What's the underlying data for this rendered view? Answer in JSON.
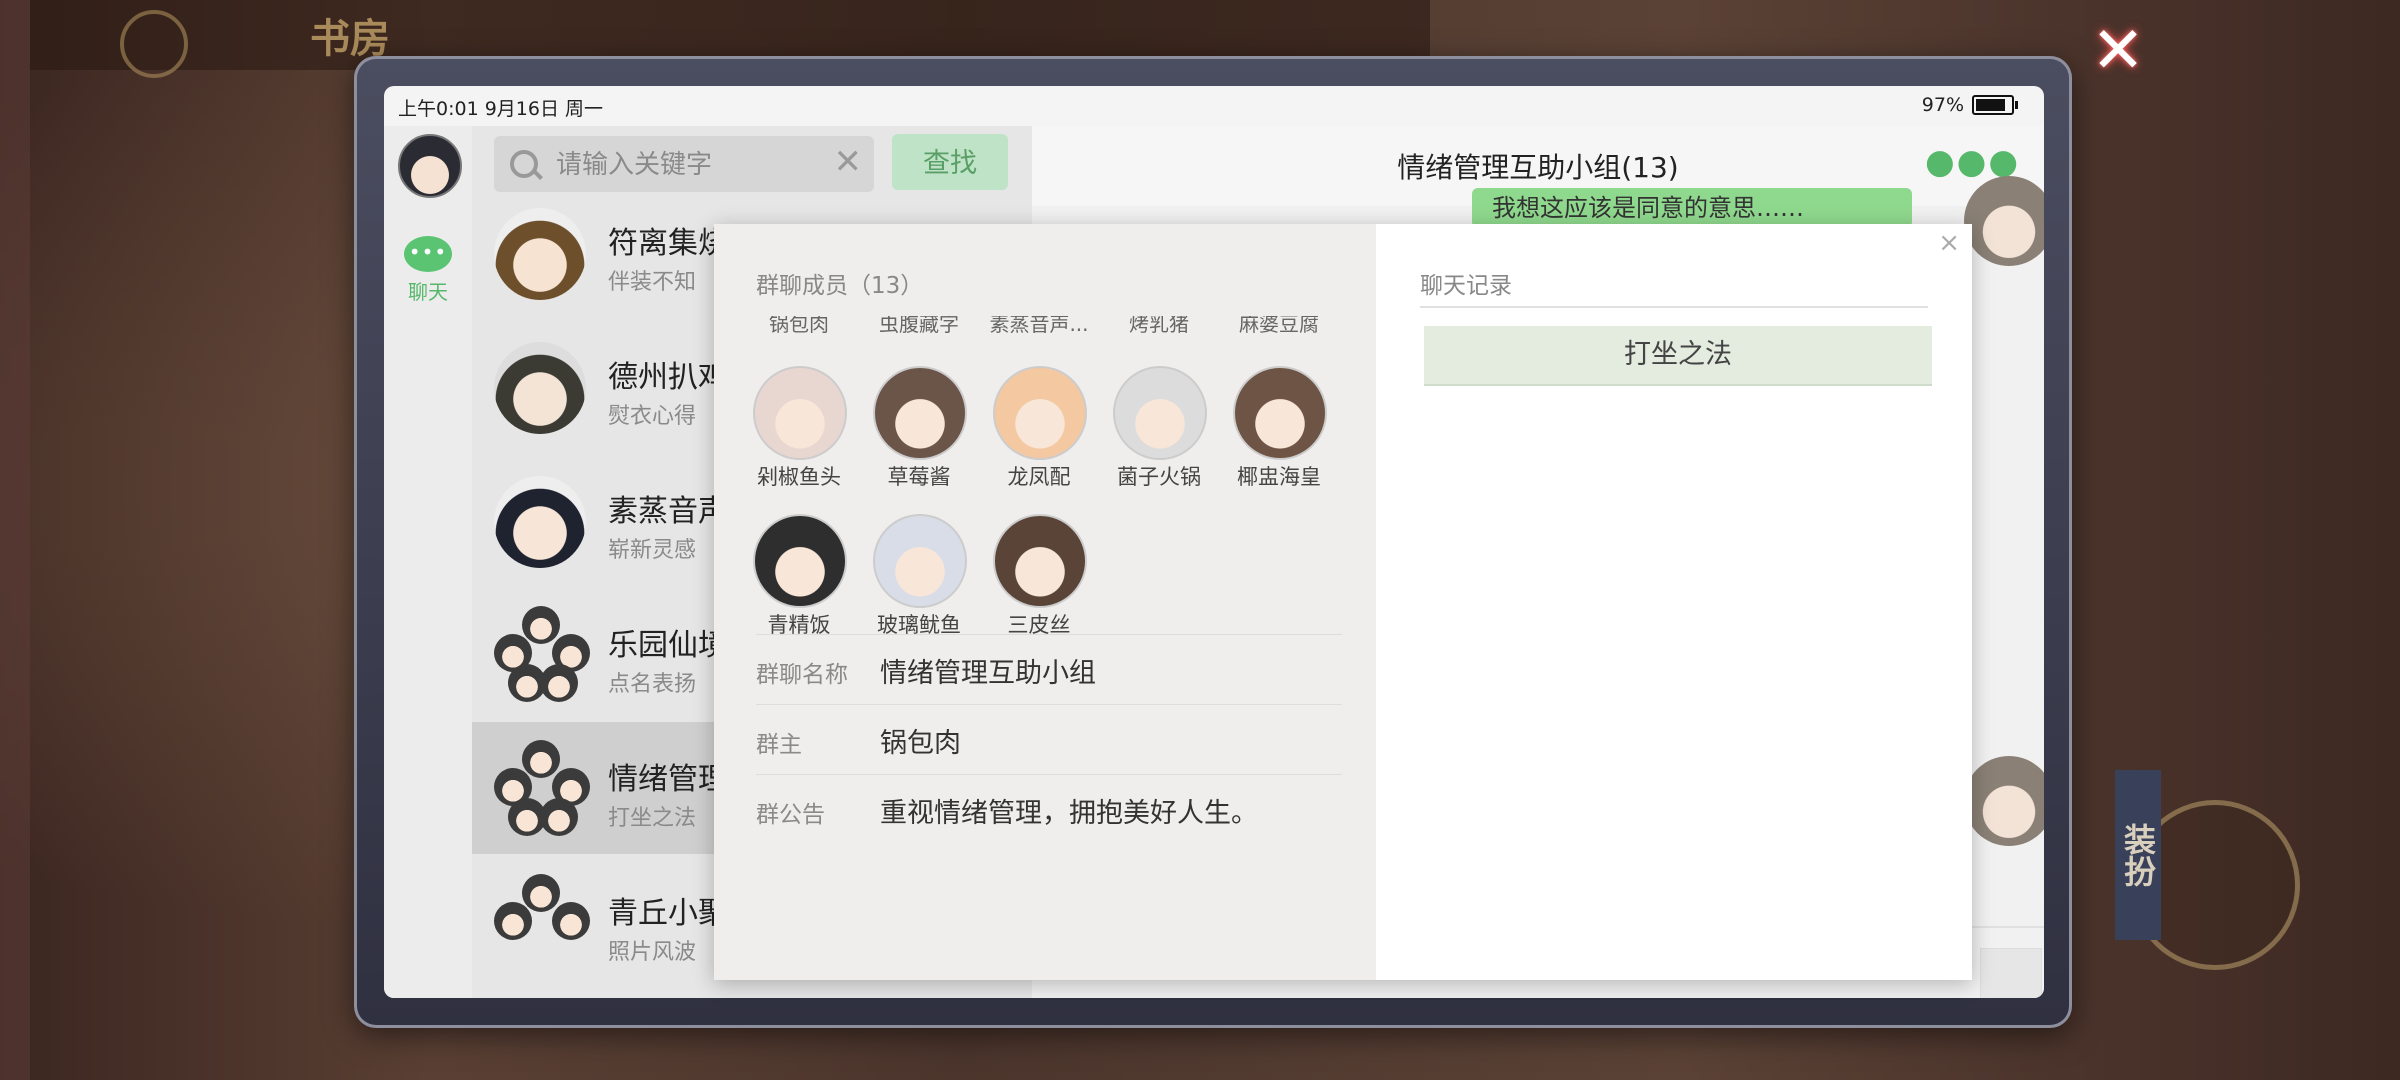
{
  "background": {
    "title": "书房",
    "dress_button": "装扮"
  },
  "statusbar": {
    "time": "上午0:01  9月16日  周一",
    "battery": "97%",
    "battery_level": 0.97
  },
  "nav": {
    "chat_tab": "聊天"
  },
  "search": {
    "placeholder": "请输入关键字",
    "button": "查找"
  },
  "conversations": [
    {
      "name": "符离集烧",
      "last": "伴装不知"
    },
    {
      "name": "德州扒鸡",
      "last": "熨衣心得"
    },
    {
      "name": "素蒸音声",
      "last": "崭新灵感"
    },
    {
      "name": "乐园仙境",
      "last": "点名表扬"
    },
    {
      "name": "情绪管理",
      "last": "打坐之法"
    },
    {
      "name": "青丘小聚",
      "last": "照片风波"
    }
  ],
  "chat": {
    "title": "情绪管理互助小组(13)",
    "visible_message": "我想这应该是同意的意思……"
  },
  "modal": {
    "members_title": "群聊成员（13）",
    "partial_row": [
      "锅包肉",
      "虫腹藏字",
      "素蒸音声...",
      "烤乳猪",
      "麻婆豆腐"
    ],
    "members": [
      {
        "name": "剁椒鱼头",
        "color": "#e8d6d0"
      },
      {
        "name": "草莓酱",
        "color": "#6b5448"
      },
      {
        "name": "龙凤配",
        "color": "#f4c8a0"
      },
      {
        "name": "菌子火锅",
        "color": "#dcdcdc"
      },
      {
        "name": "椰盅海皇",
        "color": "#6d5444"
      },
      {
        "name": "青精饭",
        "color": "#2e2e2e"
      },
      {
        "name": "玻璃鱿鱼",
        "color": "#d9dde8"
      },
      {
        "name": "三皮丝",
        "color": "#5a4438"
      }
    ],
    "group_name_label": "群聊名称",
    "group_name": "情绪管理互助小组",
    "owner_label": "群主",
    "owner": "锅包肉",
    "notice_label": "群公告",
    "notice": "重视情绪管理，拥抱美好人生。",
    "history_title": "聊天记录",
    "history_items": [
      "打坐之法"
    ],
    "close": "×"
  },
  "icons": {
    "close": "close-icon",
    "search": "search-icon",
    "clear": "clear-icon",
    "more": "more-icon",
    "chat": "chat-bubble-icon"
  },
  "colors": {
    "accent": "#56b86a",
    "search_button": "#bfe3c6",
    "history_item": "#e3ecdf",
    "active_row": "#cfcfcf"
  }
}
